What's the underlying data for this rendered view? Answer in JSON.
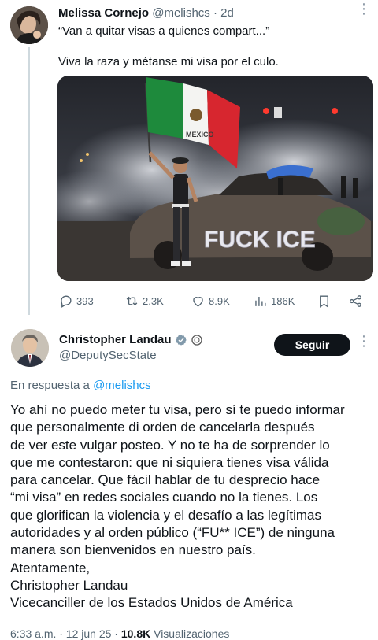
{
  "reply_tweet": {
    "author_name": "Melissa Cornejo",
    "handle": "@melishcs",
    "separator": "·",
    "time_ago": "2d",
    "quote_line": "“Van a quitar visas a quienes compart...”",
    "text": "Viva la raza y métanse mi visa por el culo.",
    "photo_text": {
      "flag_label": "MEXICO",
      "graffiti": "FUCK ICE"
    },
    "metrics": {
      "replies": "393",
      "retweets": "2.3K",
      "likes": "8.9K",
      "views": "186K"
    },
    "icons": [
      "reply-icon",
      "retweet-icon",
      "like-icon",
      "views-icon",
      "bookmark-icon",
      "share-icon"
    ]
  },
  "main_tweet": {
    "author_name": "Christopher Landau",
    "handle": "@DeputySecState",
    "follow_label": "Seguir",
    "reply_prefix": "En respuesta a",
    "reply_to": "@melishcs",
    "body": "Yo ahí no puedo meter tu visa, pero sí te puedo informar\nque personalmente di orden de cancelarla después\nde ver este vulgar posteo. Y no te ha de sorprender lo\nque me contestaron: que ni siquiera tienes visa válida\npara cancelar. Que fácil hablar de tu desprecio hace\n“mi visa” en redes sociales cuando no la tienes. Los\nque glorifican la violencia y el desafío a las legítimas\nautoridades y al orden público (“FU** ICE”) de ninguna\nmanera son bienvenidos en nuestro país.\nAtentamente,\nChristopher Landau\nVicecanciller de los Estados Unidos de América",
    "timestamp": "6:33 a.m. · 12 jun 25 ·",
    "views_count": "10.8K",
    "views_label": "Visualizaciones"
  },
  "colors": {
    "text": "#0f1419",
    "muted": "#536471",
    "link": "#1d9bf0",
    "verified_gray": "#829aab",
    "follow_button": "#0f1419"
  }
}
